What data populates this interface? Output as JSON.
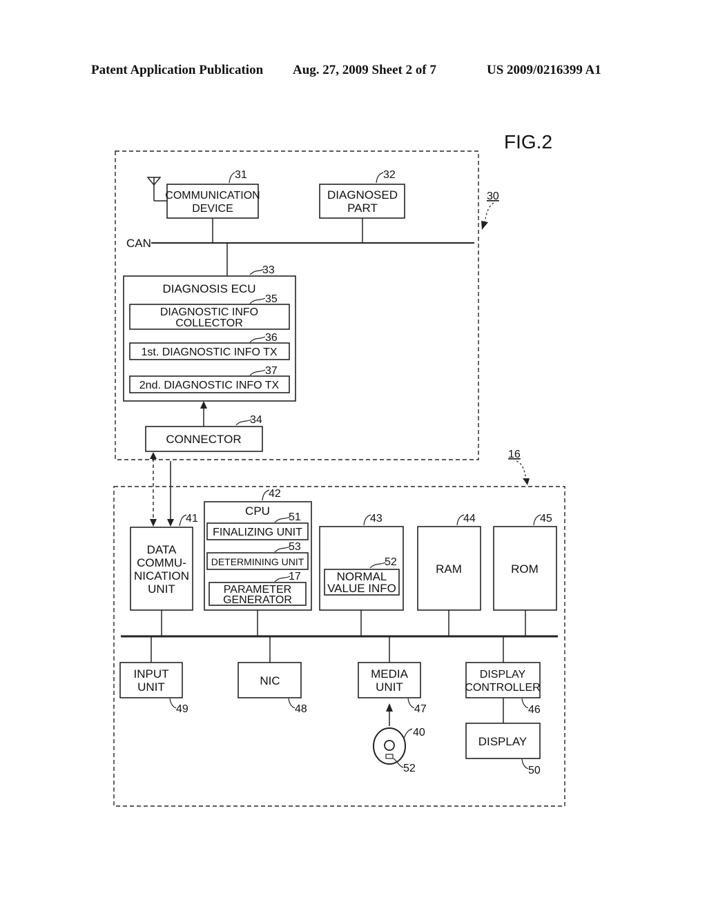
{
  "header": {
    "publication": "Patent Application Publication",
    "date_sheet": "Aug. 27, 2009  Sheet 2 of 7",
    "patent_number": "US 2009/0216399 A1"
  },
  "figure": {
    "label": "FIG.2"
  },
  "vehicle": {
    "ref": "30",
    "can_label": "CAN",
    "communication_device": {
      "ref": "31",
      "lines": [
        "COMMUNICATION",
        "DEVICE"
      ]
    },
    "diagnosed_part": {
      "ref": "32",
      "lines": [
        "DIAGNOSED",
        "PART"
      ]
    },
    "diagnosis_ecu": {
      "ref": "33",
      "title": "DIAGNOSIS ECU",
      "collector": {
        "ref": "35",
        "lines": [
          "DIAGNOSTIC INFO",
          "COLLECTOR"
        ]
      },
      "tx1": {
        "ref": "36",
        "label": "1st. DIAGNOSTIC INFO TX"
      },
      "tx2": {
        "ref": "37",
        "label": "2nd. DIAGNOSTIC INFO TX"
      }
    },
    "connector": {
      "ref": "34",
      "label": "CONNECTOR"
    }
  },
  "device": {
    "ref": "16",
    "data_comm_unit": {
      "ref": "41",
      "lines": [
        "DATA",
        "COMMU-",
        "NICATION",
        "UNIT"
      ]
    },
    "cpu": {
      "ref": "42",
      "title": "CPU",
      "finalizing": {
        "ref": "51",
        "label": "FINALIZING UNIT"
      },
      "determining": {
        "ref": "53",
        "label": "DETERMINING UNIT"
      },
      "param_gen": {
        "ref": "17",
        "lines": [
          "PARAMETER",
          "GENERATOR"
        ]
      }
    },
    "storage": {
      "ref": "43",
      "normal_value": {
        "ref": "52",
        "lines": [
          "NORMAL",
          "VALUE INFO"
        ]
      }
    },
    "ram": {
      "ref": "44",
      "label": "RAM"
    },
    "rom": {
      "ref": "45",
      "label": "ROM"
    },
    "input_unit": {
      "ref": "49",
      "lines": [
        "INPUT",
        "UNIT"
      ]
    },
    "nic": {
      "ref": "48",
      "label": "NIC"
    },
    "media_unit": {
      "ref": "47",
      "lines": [
        "MEDIA",
        "UNIT"
      ]
    },
    "display_controller": {
      "ref": "46",
      "lines": [
        "DISPLAY",
        "CONTROLLER"
      ]
    },
    "display": {
      "ref": "50",
      "label": "DISPLAY"
    },
    "disc": {
      "ref": "40",
      "data_ref": "52"
    }
  }
}
